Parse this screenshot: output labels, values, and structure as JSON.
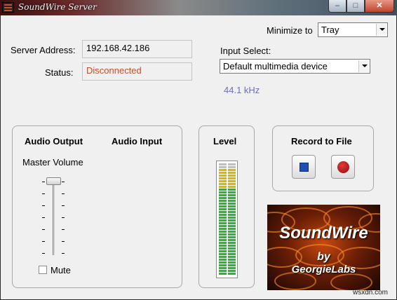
{
  "window": {
    "title": "SoundWire Server",
    "minimize_glyph": "–",
    "maximize_glyph": "□",
    "close_glyph": "✕"
  },
  "minimize_to": {
    "label": "Minimize to",
    "value": "Tray"
  },
  "server": {
    "address_label": "Server Address:",
    "address_value": "192.168.42.186",
    "status_label": "Status:",
    "status_value": "Disconnected",
    "status_color": "#d04a1a"
  },
  "input_select": {
    "label": "Input Select:",
    "value": "Default multimedia device",
    "sample_rate": "44.1 kHz",
    "sample_rate_color": "#6d6fb5"
  },
  "audio": {
    "output_heading": "Audio Output",
    "input_heading": "Audio Input",
    "master_volume_label": "Master Volume",
    "mute_label": "Mute",
    "mute_checked": false,
    "volume_level": 1.0
  },
  "level": {
    "heading": "Level"
  },
  "record": {
    "heading": "Record to File",
    "stop_icon": "stop-icon",
    "record_icon": "record-icon"
  },
  "logo": {
    "title": "SoundWire",
    "by": "by",
    "company": "GeorgieLabs"
  },
  "watermark": "wsxdn.com",
  "colors": {
    "meter_green": "#1fbf1f",
    "meter_yellow": "#e0b300",
    "meter_red": "#c0c0c0"
  }
}
